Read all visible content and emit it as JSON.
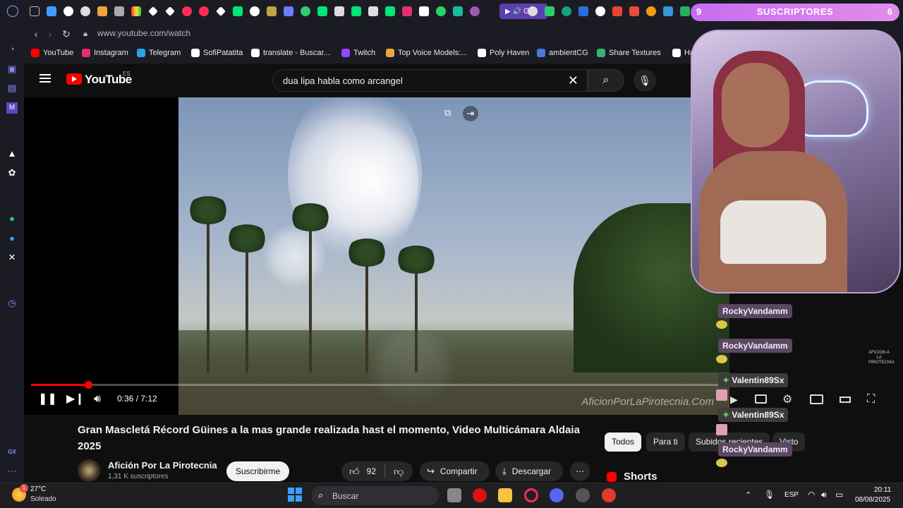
{
  "browser": {
    "url": "www.youtube.com/watch",
    "active_tab_label": "Gra",
    "bookmarks": [
      {
        "label": "YouTube",
        "color": "#ff0000"
      },
      {
        "label": "Instagram",
        "color": "#e1306c"
      },
      {
        "label": "Telegram",
        "color": "#2aa5e0"
      },
      {
        "label": "SofiPatatita",
        "color": "#ffffff"
      },
      {
        "label": "translate - Buscar...",
        "color": "#ffffff"
      },
      {
        "label": "Twitch",
        "color": "#9146ff"
      },
      {
        "label": "Top Voice Models:...",
        "color": "#e8a93c"
      },
      {
        "label": "Poly Haven",
        "color": "#ffffff"
      },
      {
        "label": "ambientCG",
        "color": "#4a7bd8"
      },
      {
        "label": "Share Textures",
        "color": "#3bb273"
      },
      {
        "label": "Ha",
        "color": "#ffffff"
      }
    ]
  },
  "youtube": {
    "logo_text": "YouTube",
    "region": "ES",
    "search_query": "dua lipa habla como arcangel",
    "player": {
      "current_time": "0:36 / 7:12",
      "progress_fraction": 0.083,
      "watermark": "AficionPorLaPirotecnia.Com",
      "corner_logo": "AFICION A LA PIROTECNIA"
    },
    "video_title": "Gran Mascletá Récord Güines a la mas grande realizada hast el momento, Video Multicámara Aldaia 2025",
    "channel": {
      "name": "Afición Por La Pirotecnia",
      "subscribers": "1,31 K suscriptores",
      "subscribe_label": "Suscribirme"
    },
    "actions": {
      "likes": "92",
      "share": "Compartir",
      "download": "Descargar"
    },
    "chips": [
      "Todos",
      "Para ti",
      "Subidos recientes",
      "Visto"
    ],
    "shorts_label": "Shorts"
  },
  "stream_overlay": {
    "subs_left": "9",
    "subs_label": "SUSCRIPTORES",
    "subs_right": "6",
    "chat": [
      {
        "user": "RockyVandamm",
        "style": "purple"
      },
      {
        "user": "RockyVandamm",
        "style": "purple"
      },
      {
        "user": "Valentin89Sx",
        "style": "green"
      },
      {
        "user": "Valentin89Sx",
        "style": "green"
      },
      {
        "user": "RockyVandamm",
        "style": "purple"
      }
    ]
  },
  "taskbar": {
    "weather_temp": "27°C",
    "weather_desc": "Soleado",
    "weather_badge": "1",
    "search_placeholder": "Buscar",
    "language": "ESP",
    "time": "20:11",
    "date": "08/08/2025"
  },
  "sidebar_footer_label": "GX"
}
